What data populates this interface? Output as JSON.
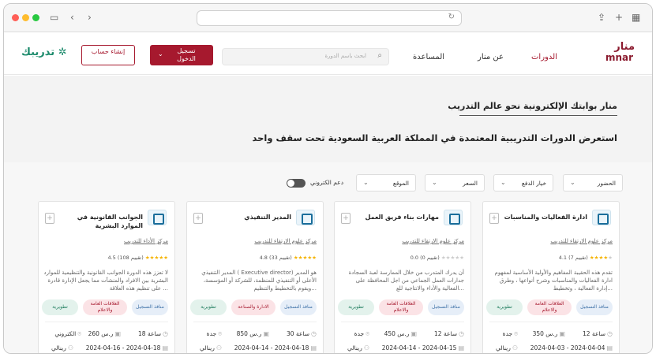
{
  "header": {
    "brand_ar": "منار",
    "brand_en": "mnar",
    "nav": [
      "الدورات",
      "عن منار",
      "المساعدة"
    ],
    "search_placeholder": "ابحث باسم الدورة",
    "login": "تسجيل الدخول",
    "register": "إنشاء حساب",
    "tadreeb": "تدريبك"
  },
  "hero": {
    "title": "منار بوابتك الإلكترونية نحو عالم التدريب",
    "subtitle": "استعرض الدورات التدريبية المعتمدة في المملكة العربية السعودية تحت سقف واحد"
  },
  "filters": {
    "attendance": "الحضور",
    "payment": "خيار الدفع",
    "price": "السعر",
    "location": "الموقع",
    "online_support": "دعم الكتروني"
  },
  "courses": [
    {
      "title": "ادارة الفعاليات والمناسبات",
      "org": "مركز علوم الارتقاء للتدريب",
      "rating_text": "4.1 (7 تقييم)",
      "stars_on": 4,
      "description": "تقدم هذه الحقيبة المفاهيم والأولية الأساسية لمفهوم ادارة الفعاليات والمناسبات وشرح أنواعها ، وطرق إدارة الفعالية ، وتخطيط...",
      "tags": [
        "منافذ التسجيل",
        "العلاقات العامة والاعلام",
        "تطويرية"
      ],
      "hours": "12 ساعة",
      "price": "350 ر.س",
      "city": "جدة",
      "dates": "2024-04-03 - 2024-04-04",
      "seats": "رينالي"
    },
    {
      "title": "مهارات بناء فريق العمل",
      "org": "مركز علوم الارتقاء للتدريب",
      "rating_text": "0.0 (0 تقييم)",
      "stars_on": 0,
      "description": "أن يدرك المتدرب من خلال الممارسة لعبة السجادة جدارات العمل الجماعي من اجل المحافظة على الفعالية والأداء والانتاجية للع...",
      "tags": [
        "منافذ التسجيل",
        "العلاقات العامة والاعلام",
        "تطويرية"
      ],
      "hours": "12 ساعة",
      "price": "450 ر.س",
      "city": "جدة",
      "dates": "2024-04-14 - 2024-04-15",
      "seats": "رينالي"
    },
    {
      "title": "المدير التنفيذي",
      "org": "مركز علوم الارتقاء للتدريب",
      "rating_text": "4.8 (33 تقييم)",
      "stars_on": 5,
      "description": "المدير التنفيذي ( Executive director) هو المدير الأعلى أو التنفيذي للمنظمة، للشركة أو المؤسسة، ويقوم بالتخطيط والتنظيم...",
      "tags": [
        "منافذ التسجيل",
        "الادارة والصناعة",
        "تطويرية"
      ],
      "hours": "30 ساعة",
      "price": "850 ر.س",
      "city": "جدة",
      "dates": "2024-04-14 - 2024-04-18",
      "seats": "رينالي"
    },
    {
      "title": "الجوانب القانونية في الموارد البشرية",
      "org": "مركز الأداء للتدريب",
      "rating_text": "4.5 (108 تقييم)",
      "stars_on": 5,
      "description": "لا تعزز هذه الدورة الجوانب القانونية والتنظيمية للموارد البشرية بين الافراد والمنشآت مما يجعل الإدارة قادرة على تنظيم هذه العلاقة ...",
      "tags": [
        "منافذ التسجيل",
        "العلاقات العامة والاعلام",
        "تطويرية"
      ],
      "hours": "18 ساعة",
      "price": "260 ر.س",
      "city": "الكتروني",
      "dates": "2024-04-16 - 2024-04-18",
      "seats": "رينالي"
    }
  ],
  "colors": {
    "brand": "#a6192e",
    "tadreeb": "#1b8a6b",
    "star": "#f5b301"
  },
  "icons": [
    "sidebar-icon",
    "back-icon",
    "forward-icon",
    "reload-icon",
    "share-icon",
    "new-tab-icon",
    "tabs-grid-icon",
    "search-icon",
    "bookmark-icon",
    "clock-icon",
    "money-icon",
    "location-icon",
    "calendar-icon",
    "seat-icon"
  ]
}
